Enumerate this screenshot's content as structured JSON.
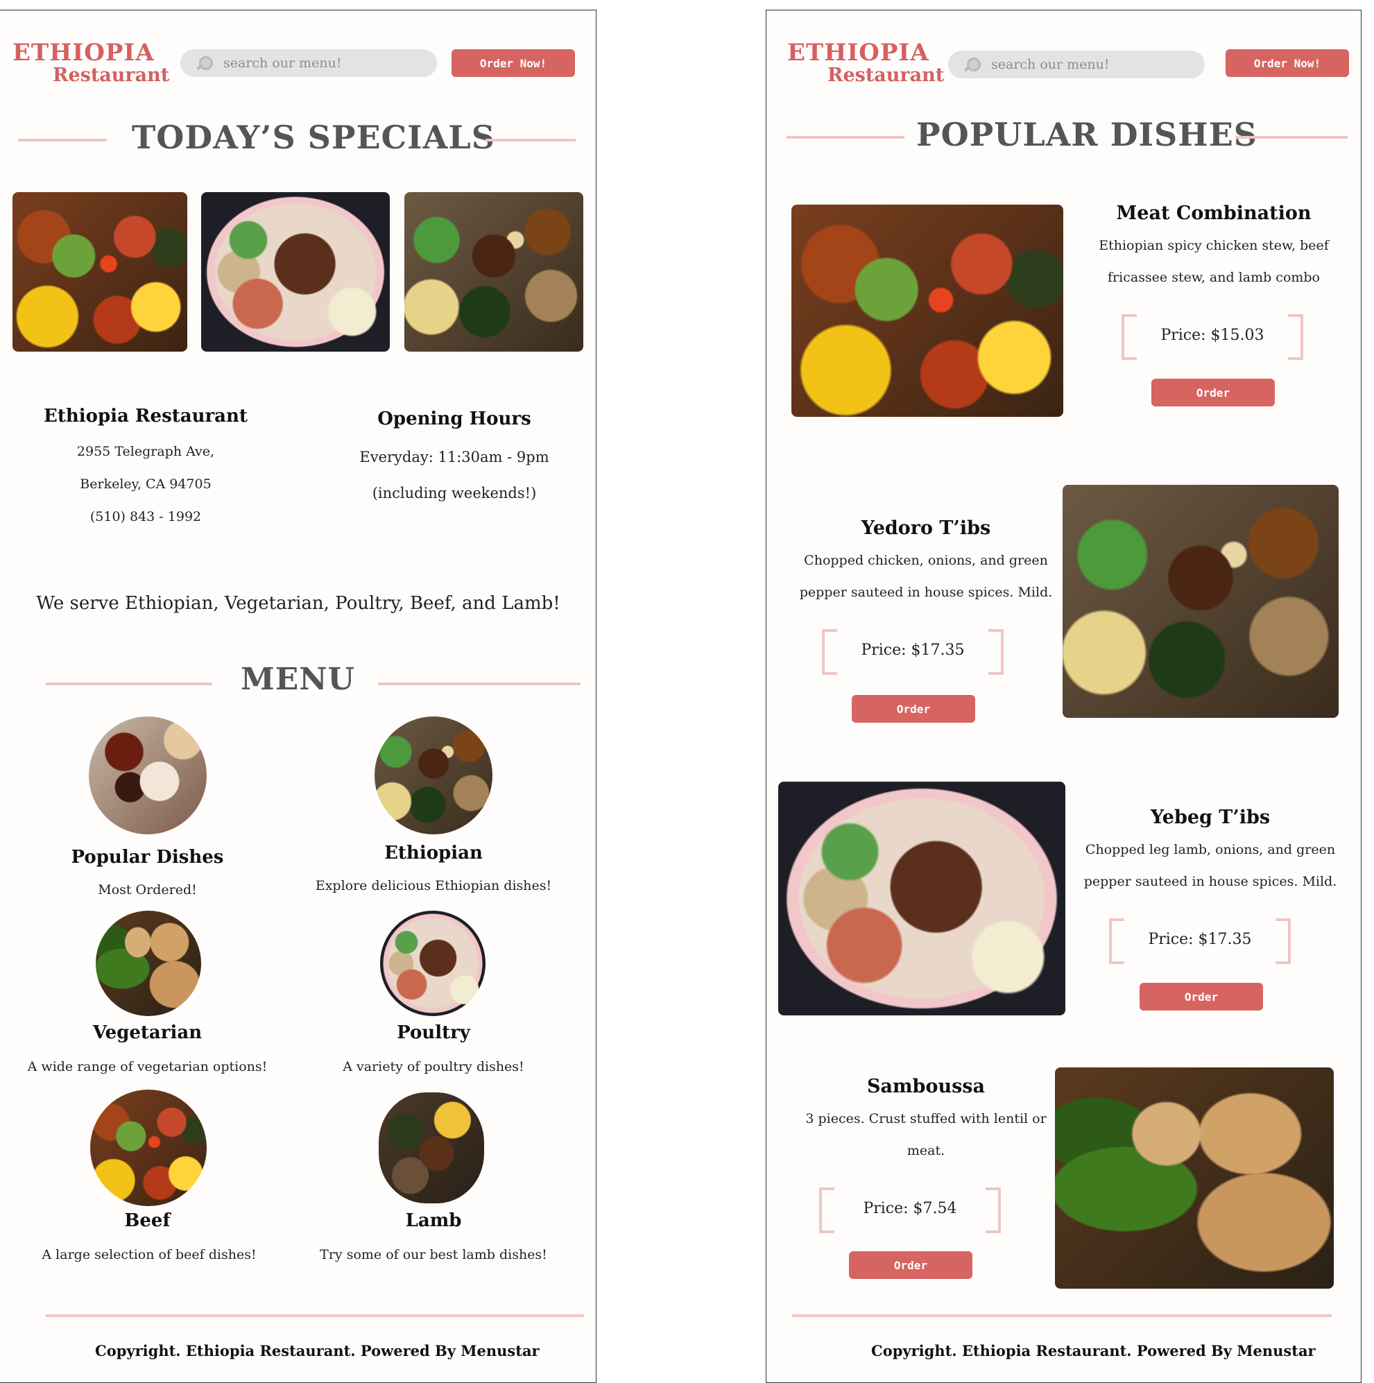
{
  "brand": {
    "line1": "ETHIOPIA",
    "line2": "Restaurant"
  },
  "search": {
    "placeholder": "search our menu!"
  },
  "header": {
    "order_label": "Order Now!"
  },
  "left": {
    "specials_title": "TODAY’S SPECIALS",
    "info": {
      "name": "Ethiopia Restaurant",
      "address1": "2955 Telegraph Ave,",
      "address2": "Berkeley, CA 94705",
      "phone": "(510) 843 - 1992",
      "hours_title": "Opening Hours",
      "hours1": "Everyday: 11:30am - 9pm",
      "hours2": "(including weekends!)"
    },
    "serve": "We serve Ethiopian, Vegetarian, Poultry, Beef, and Lamb!",
    "menu_title": "MENU",
    "menu": [
      {
        "title": "Popular Dishes",
        "desc": "Most Ordered!"
      },
      {
        "title": "Ethiopian",
        "desc": "Explore delicious Ethiopian dishes!"
      },
      {
        "title": "Vegetarian",
        "desc": "A wide range of vegetarian options!"
      },
      {
        "title": "Poultry",
        "desc": "A variety of poultry dishes!"
      },
      {
        "title": "Beef",
        "desc": "A large selection of beef dishes!"
      },
      {
        "title": "Lamb",
        "desc": "Try some of our best lamb dishes!"
      }
    ],
    "footer": "Copyright. Ethiopia Restaurant. Powered By Menustar"
  },
  "right": {
    "popular_title": "POPULAR DISHES",
    "dishes": [
      {
        "name": "Meat Combination",
        "desc1": "Ethiopian spicy chicken stew, beef",
        "desc2": "fricassee stew, and lamb combo",
        "price": "Price: $15.03",
        "order": "Order"
      },
      {
        "name": "Yedoro T’ibs",
        "desc1": "Chopped chicken, onions, and green",
        "desc2": "pepper sauteed in house spices. Mild.",
        "price": "Price: $17.35",
        "order": "Order"
      },
      {
        "name": "Yebeg T’ibs",
        "desc1": "Chopped leg lamb, onions, and green",
        "desc2": "pepper sauteed in house spices. Mild.",
        "price": "Price: $17.35",
        "order": "Order"
      },
      {
        "name": "Samboussa",
        "desc1": "3 pieces. Crust stuffed with lentil or",
        "desc2": "meat.",
        "price": "Price: $7.54",
        "order": "Order"
      }
    ],
    "footer": "Copyright. Ethiopia Restaurant. Powered By Menustar"
  },
  "colors": {
    "accent": "#d66562",
    "rule": "#efc6c7",
    "title_gray": "#555555"
  }
}
